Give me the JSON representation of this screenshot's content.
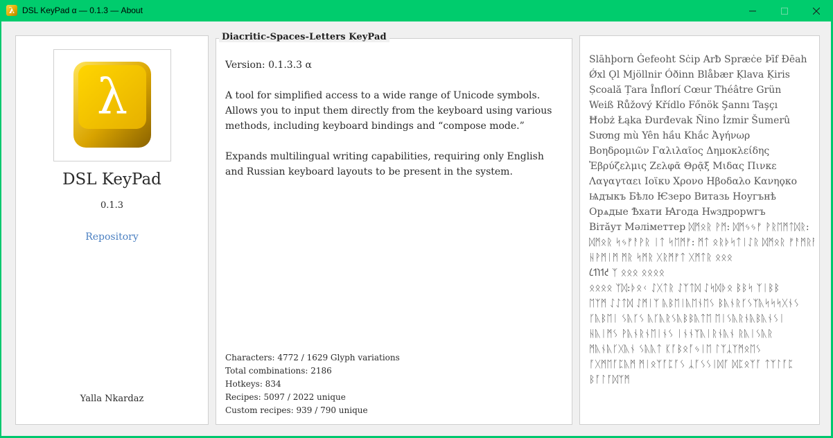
{
  "window": {
    "title": "DSL KeyPad α — 0.1.3 — About",
    "app_icon_glyph": "λ",
    "buttons": [
      "minimize-icon",
      "maximize-icon",
      "close-icon"
    ],
    "frame_color": "#00cc6d"
  },
  "left": {
    "logo_glyph": "λ",
    "app_name": "DSL KeyPad",
    "version": "0.1.3",
    "repository_label": "Repository",
    "author": "Yalla Nkardaz",
    "link_color": "#4a7fc1"
  },
  "middle": {
    "legend": "Diacritic-Spaces-Letters KeyPad",
    "version_line": "Version: 0.1.3.3 α",
    "description_1": "A tool for simplified access to a wide range of Unicode symbols. Allows you to input them directly from the keyboard using various methods, including keyboard bindings and “compose mode.”",
    "description_2": "Expands multilingual writing capabilities, requiring only English and Russian keyboard layouts to be present in the system.",
    "stats": [
      "Characters: 4772 / 1629 Glyph variations",
      "Total combinations: 2186",
      "Hotkeys: 834",
      "Recipes: 5097 / 2022 unique",
      "Custom recipes: 939 / 790 unique"
    ]
  },
  "right": {
    "sample_lines": [
      "Slāhþorn Ġefeoht Sċip Arƀ Spræċe Þīf Ðēah",
      "Ǿxl Ǫl Mjöllnir Óðinn Blåbær Ķlava Ķiris",
      "Școală Țara Înflorí Cœur Théâtre Grün",
      "Weiß Růžový Křídlo Főnök Şannı Taşçı",
      "Ħobż Łąka Đurđevak Ñino İzmir Šumerû",
      "Sương mù Yên hầu Khắc Ἀγήνωρ",
      "Βοηδρομιῶν Γαλιλαῖος Δημοκλείδης",
      "Ἐβρύζελμις Ζελφᾶ Θρᾷξ Μιδας Πινκε",
      "Λαγαγταει Ιοϊκυ Χρονο Ηβοδαλο Κανηϙκο",
      "Ѩдꙑкъ Бѣло Ѥзеро Витазь Ноугънѣ",
      "Орѧдые Ѣхати Ꙗгода Нѡздрорwгъ",
      "Вітӑут Мәліметтер ᛞᛗᛟᚱ ᚹᛗ: ᛞᛗᛃᛃᚠ ᚹᚱᛖᛗᛏᛞᚱ:",
      "ᛞᛗᛟᚱ ᛋᛃᚠᚨᚹᚱ ᛁᛏ ᛋᛖᛗᚠ: ᛗᛏ ᛟᚱᚦᛋᛏᛁᛇᚱ ᛞᛗᛟᚱ ᚠᚨᛗᚱᛗᚷᛁ:",
      "ᚺᚹᛗᛁᛗ ᛗᚱ ᛋᛗᚱ ᚷᚱᛗᚠᛏ ᚷᛗᛏᚱ ᛟ‌ᛟ‌ᛟ",
      "𐑖𐑑𐑐𐑑𐑒 ᛉ ᛟᛟᛟ ᛟᛟᛟᛟ",
      "ᛟᛟᛟᛟ ᛉᛞ:ᚦᛟᚲ ᛇᚷᛏᚱ ᛇᛉᛏᛞ ᛇᛋᛞᚦᛟ ᛒᛒᛋ ᛉᛁᛒᛒ",
      "ᛖᛉᛗ ᛇᛇᛏᛞ ᛇᛗᛁᛉ ᚣᛒᛖᛁᚣᛖᚾᛖᛊ ᛒᚣᚾᚱᚴᛊᛉᚣᛋᛋᛋᚷᚾᛊ",
      "ᚴᚣᛒᛖᛁ ᛊᚣᚴᛊ ᚣᚴᚣᚱᛊᚣᛒᛒᚣᛏᛖ ᛖᛁᛊᚣᚱᚾᚣᛒᚣᚾᛊᛁ",
      "ᚺᚣᛁᛗᛊ ᚹᚣᚾᚱᚾᛖᛁᚾᛊ ᛁᚾᚾᛉᚣᛁᚱᚾᚣᚾ ᚱᚣᛁᛊᚣᚱ",
      "ᛗᚣᚾᚣᚴᚷᚣᚾ ᛊᚣᚣᛏ ᛕᚪᛒᛟᚪᛃᛁᛖ ᛚᛉᛣᛉᛗᛟᛖᛊ",
      "ᚪᚷᛗᛖᚪᛈᚣᛗ ᛗᛁᛟᛉᚪᛈᚪᛊ ᛣᚪᛊᛊᛁᛞᚪ ᛞᛈᛟᛉᚪ ᛏᛉᛚᚪᛈ",
      "ᛒᚪᛚᚪᛞᛉᛗ"
    ]
  }
}
